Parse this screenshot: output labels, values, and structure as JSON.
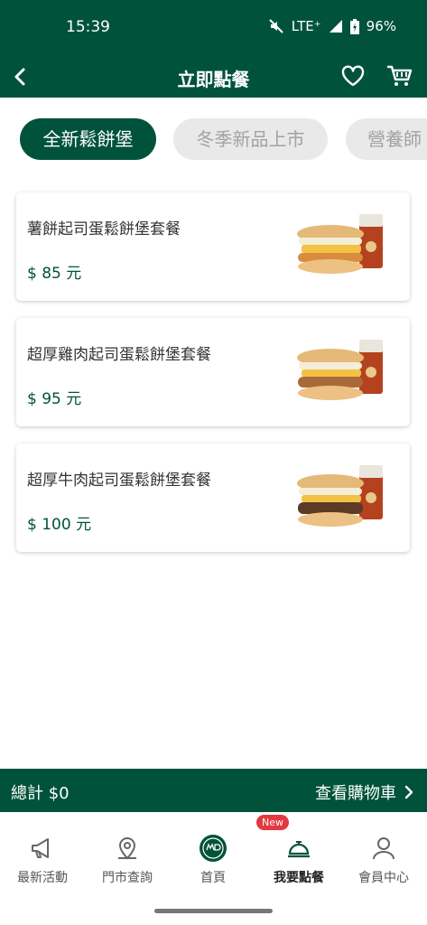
{
  "status_bar": {
    "time": "15:39",
    "network": "LTE⁺",
    "battery": "96%"
  },
  "header": {
    "title": "立即點餐"
  },
  "tabs": [
    {
      "label": "全新鬆餅堡",
      "active": true
    },
    {
      "label": "冬季新品上市",
      "active": false
    },
    {
      "label": "營養師",
      "active": false
    }
  ],
  "products": [
    {
      "name": "薯餅起司蛋鬆餅堡套餐",
      "price": "$ 85 元"
    },
    {
      "name": "超厚雞肉起司蛋鬆餅堡套餐",
      "price": "$ 95 元"
    },
    {
      "name": "超厚牛肉起司蛋鬆餅堡套餐",
      "price": "$ 100 元"
    }
  ],
  "cart_bar": {
    "total": "總計 $0",
    "view_cart": "查看購物車"
  },
  "bottom_nav": {
    "badge": "New",
    "items": [
      {
        "label": "最新活動",
        "icon": "megaphone-icon"
      },
      {
        "label": "門市查詢",
        "icon": "location-pin-icon"
      },
      {
        "label": "首頁",
        "icon": "mwd-logo-icon"
      },
      {
        "label": "我要點餐",
        "icon": "service-bell-icon",
        "active": true
      },
      {
        "label": "會員中心",
        "icon": "user-icon"
      }
    ]
  },
  "colors": {
    "brand": "#00533a",
    "badge": "#e2383f",
    "inactive_tab": "#e9e9e9"
  }
}
